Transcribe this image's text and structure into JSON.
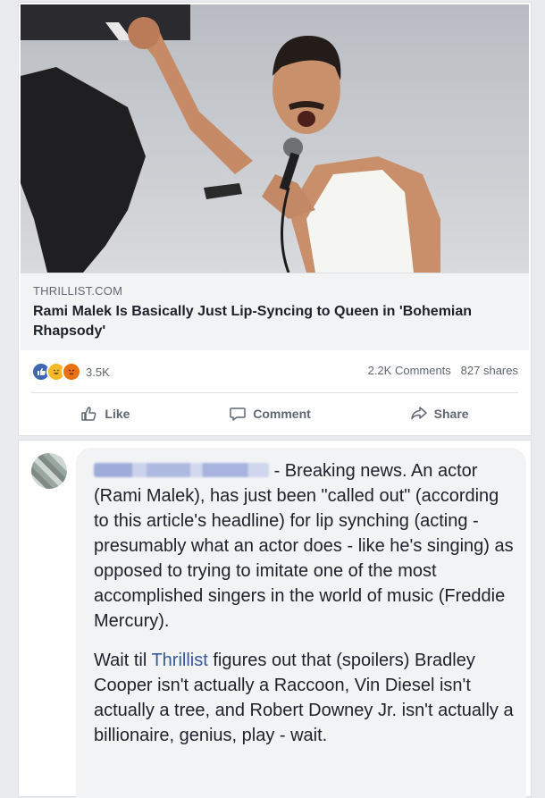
{
  "post": {
    "source": "THRILLIST.COM",
    "headline": "Rami Malek Is Basically Just Lip-Syncing to Queen in 'Bohemian Rhapsody'",
    "reactions_icons": [
      "like-icon",
      "haha-icon",
      "angry-icon"
    ],
    "reaction_count": "3.5K",
    "comments_count": "2.2K Comments",
    "shares_count": "827 shares",
    "actions": {
      "like": "Like",
      "comment": "Comment",
      "share": "Share"
    }
  },
  "comment": {
    "text_intro": "- Breaking news. An actor (Rami Malek), has just been \"called out\" (according to this article's headline) for lip synching (acting - presumably what an actor does - like he's singing) as opposed to trying to imitate one of the most accomplished singers in the world of music (Freddie Mercury).",
    "text_p2_before": "Wait til ",
    "text_p2_link": "Thrillist",
    "text_p2_after": " figures out that (spoilers) Bradley Cooper isn't actually a Raccoon, Vin Diesel isn't actually a tree, and Robert Downey Jr. isn't actually a billionaire, genius, play - wait."
  },
  "colors": {
    "link": "#385898",
    "like_blue": "#4267b2",
    "haha_yellow": "#f7b928",
    "angry_orange": "#e9710f"
  }
}
